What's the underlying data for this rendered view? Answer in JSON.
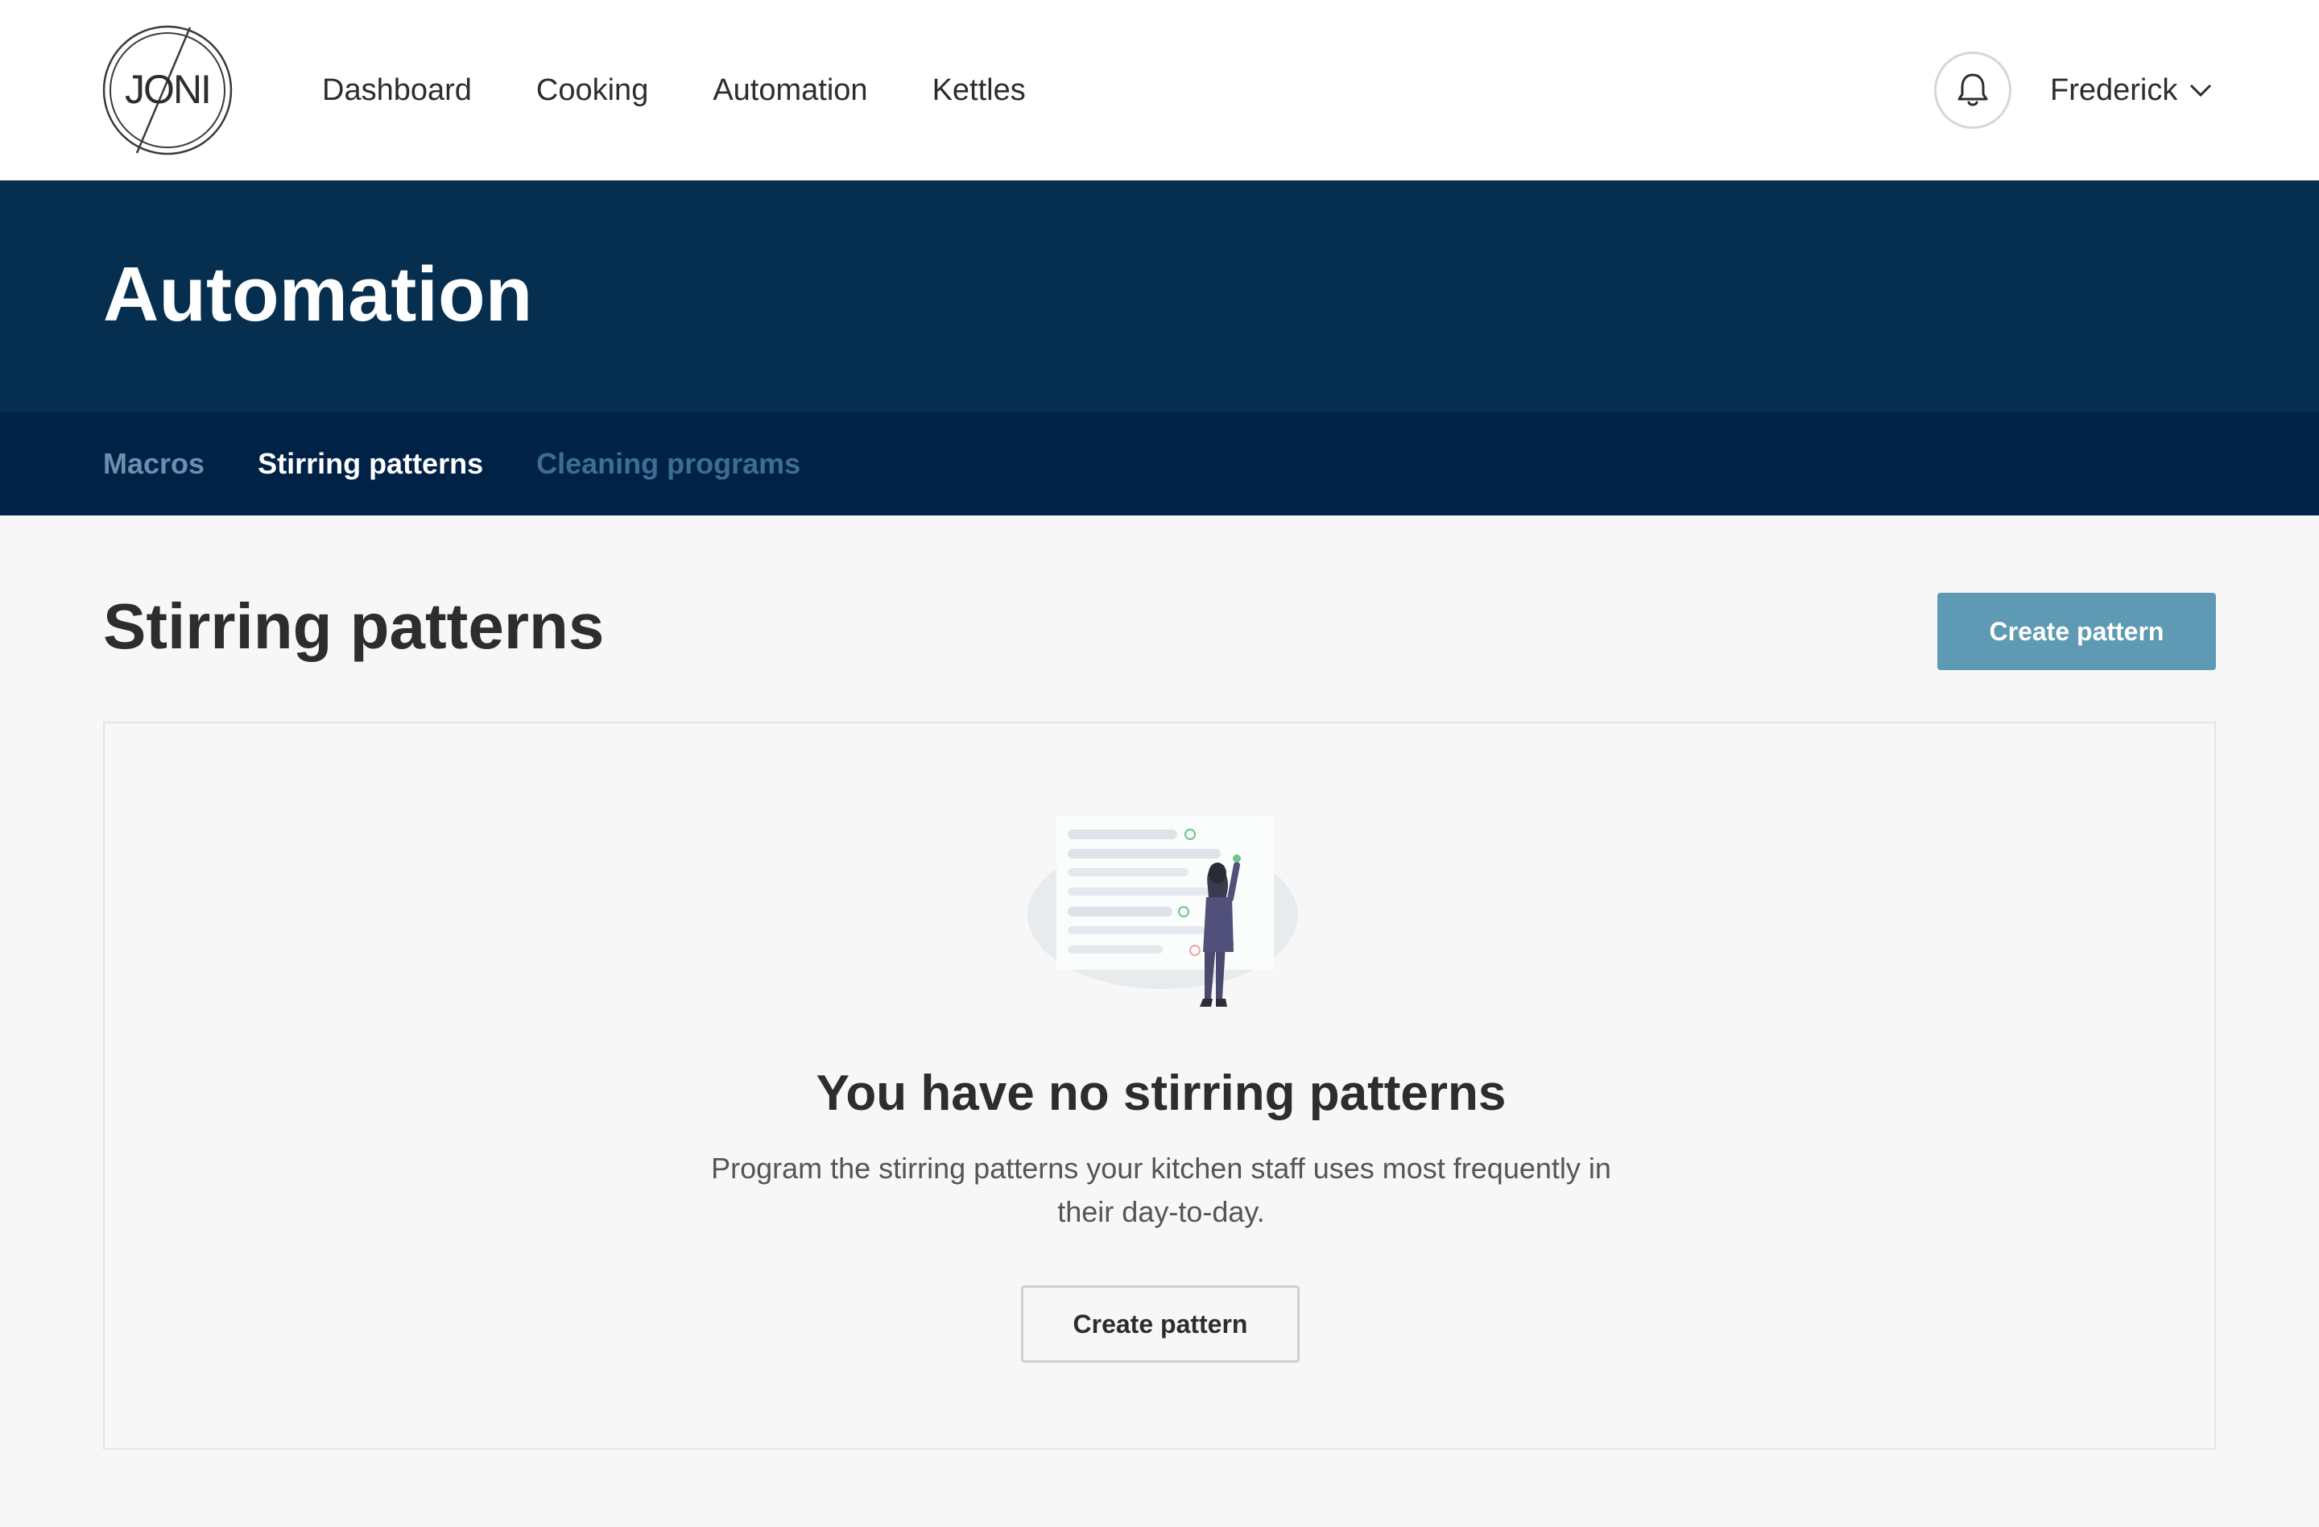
{
  "brand": {
    "logo_text": "JONI",
    "logo_icon": "joni-logo"
  },
  "nav": {
    "items": [
      {
        "label": "Dashboard"
      },
      {
        "label": "Cooking"
      },
      {
        "label": "Automation"
      },
      {
        "label": "Kettles"
      }
    ],
    "notification_icon": "bell-icon",
    "user_name": "Frederick",
    "user_menu_icon": "chevron-down-icon"
  },
  "hero": {
    "title": "Automation",
    "tabs": [
      {
        "label": "Macros",
        "active": false
      },
      {
        "label": "Stirring patterns",
        "active": true
      },
      {
        "label": "Cleaning programs",
        "active": false
      }
    ]
  },
  "main": {
    "title": "Stirring patterns",
    "create_button": "Create pattern",
    "empty_state": {
      "illustration": "person-checklist-illustration",
      "title": "You have no stirring patterns",
      "description_line1": "Program the stirring patterns your kitchen staff uses most frequently in",
      "description_line2": "their day-to-day.",
      "button": "Create pattern"
    }
  },
  "colors": {
    "hero_bg": "#062f4f",
    "subnav_bg": "#012247",
    "primary_button": "#5e9ab4",
    "page_bg": "#f7f7f7"
  }
}
